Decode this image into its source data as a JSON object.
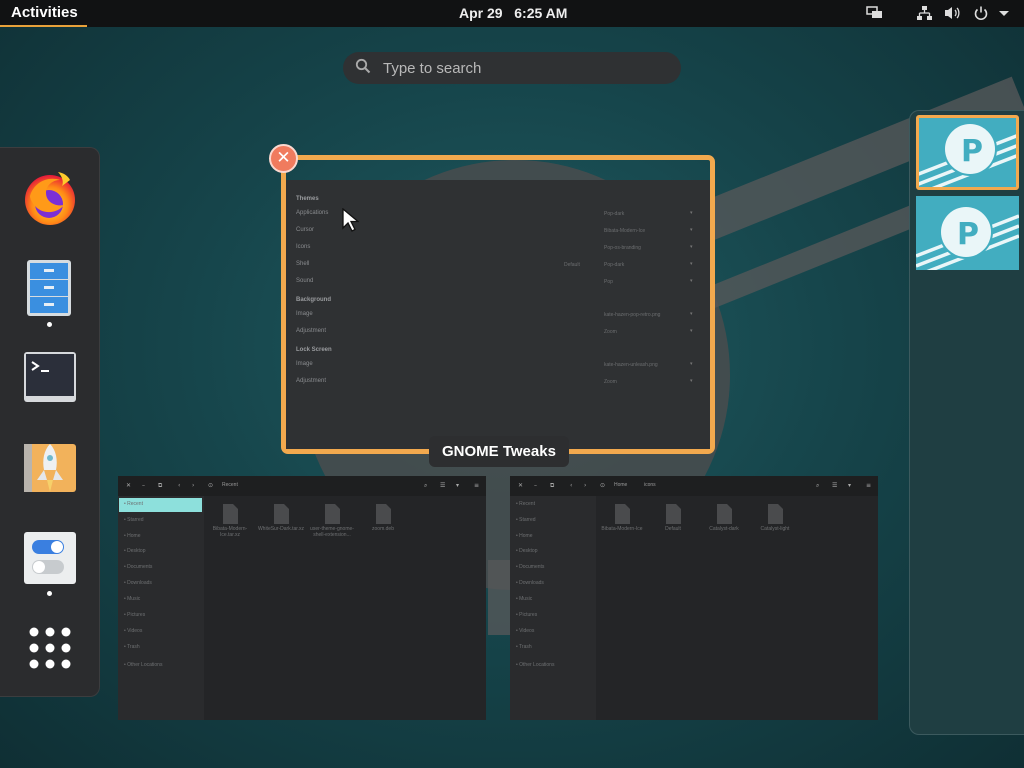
{
  "topbar": {
    "activities": "Activities",
    "date": "Apr 29",
    "time": "6:25 AM"
  },
  "search": {
    "placeholder": "Type to search"
  },
  "dash": {
    "apps": [
      {
        "name": "Firefox",
        "icon": "firefox-icon",
        "running": false
      },
      {
        "name": "Files",
        "icon": "file-cabinet-icon",
        "running": true
      },
      {
        "name": "Terminal",
        "icon": "terminal-icon",
        "running": false
      },
      {
        "name": "Pop!_Shop",
        "icon": "rocket-icon",
        "running": false
      },
      {
        "name": "Tweaks",
        "icon": "toggle-switches-icon",
        "running": true
      },
      {
        "name": "Show Applications",
        "icon": "app-grid-icon",
        "running": false
      }
    ]
  },
  "windows": {
    "tweaks": {
      "title": "GNOME Tweaks",
      "sections": [
        {
          "heading": "Themes",
          "rows": [
            {
              "label": "Applications",
              "value": "Pop-dark"
            },
            {
              "label": "Cursor",
              "value": "Bibata-Modern-Ice"
            },
            {
              "label": "Icons",
              "value": "Pop-os-branding"
            },
            {
              "label": "Shell",
              "value": "Pop-dark",
              "extra": "Default"
            },
            {
              "label": "Sound",
              "value": "Pop"
            }
          ]
        },
        {
          "heading": "Background",
          "rows": [
            {
              "label": "Image",
              "value": "kate-hazen-pop-retro.png"
            },
            {
              "label": "Adjustment",
              "value": "Zoom"
            }
          ]
        },
        {
          "heading": "Lock Screen",
          "rows": [
            {
              "label": "Image",
              "value": "kate-hazen-unleash.png"
            },
            {
              "label": "Adjustment",
              "value": "Zoom"
            }
          ]
        }
      ]
    },
    "files_left": {
      "location": "Recent",
      "sidebar": [
        "Recent",
        "Starred",
        "Home",
        "Desktop",
        "Documents",
        "Downloads",
        "Music",
        "Pictures",
        "Videos",
        "Trash",
        "Other Locations"
      ],
      "files": [
        "Bibata-Modern-Ice.tar.xz",
        "WhiteSur-Dark.tar.xz",
        "user-theme-gnome-shell-extension...",
        "zoom.deb"
      ]
    },
    "files_right": {
      "location": "Home",
      "sublocation": "icons",
      "sidebar": [
        "Recent",
        "Starred",
        "Home",
        "Desktop",
        "Documents",
        "Downloads",
        "Music",
        "Pictures",
        "Videos",
        "Trash",
        "Other Locations"
      ],
      "files": [
        "Bibata-Modern-Ice",
        "Default",
        "Catalyst-dark",
        "Catalyst-light"
      ]
    }
  },
  "colors": {
    "accent": "#f2a94e",
    "topbar": "#111213",
    "close": "#f07b5e",
    "workspace": "#42adc0",
    "selection": "#8de0dc"
  }
}
